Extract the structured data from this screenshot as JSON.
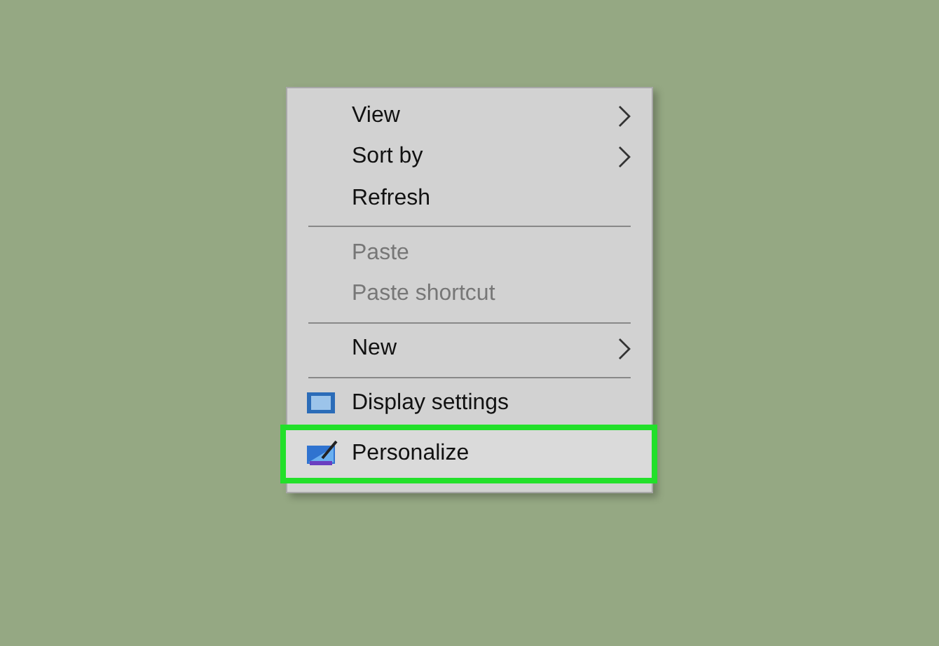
{
  "context_menu": {
    "items": [
      {
        "kind": "item",
        "label": "View",
        "submenu": true,
        "disabled": false,
        "highlighted": false
      },
      {
        "kind": "item",
        "label": "Sort by",
        "submenu": true,
        "disabled": false,
        "highlighted": false
      },
      {
        "kind": "item",
        "label": "Refresh",
        "submenu": false,
        "disabled": false,
        "highlighted": false
      },
      {
        "kind": "separator"
      },
      {
        "kind": "item",
        "label": "Paste",
        "submenu": false,
        "disabled": true,
        "highlighted": false
      },
      {
        "kind": "item",
        "label": "Paste shortcut",
        "submenu": false,
        "disabled": true,
        "highlighted": false
      },
      {
        "kind": "separator"
      },
      {
        "kind": "item",
        "label": "New",
        "submenu": true,
        "disabled": false,
        "highlighted": false
      },
      {
        "kind": "separator"
      },
      {
        "kind": "monitor",
        "label": "Display settings",
        "submenu": false,
        "disabled": false,
        "highlighted": false
      },
      {
        "kind": "brush",
        "label": "Personalize",
        "submenu": false,
        "disabled": false,
        "highlighted": true
      }
    ]
  }
}
